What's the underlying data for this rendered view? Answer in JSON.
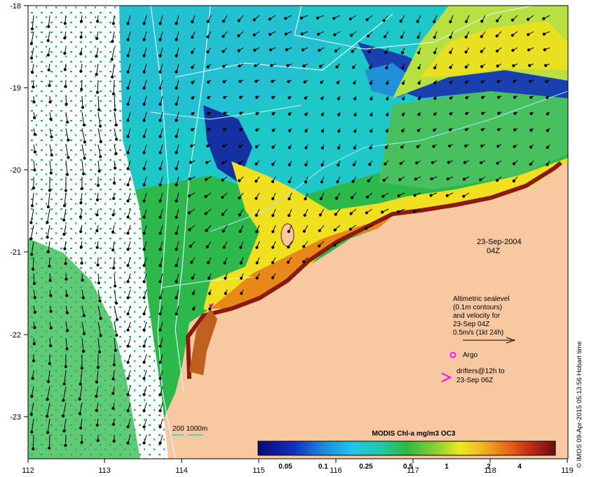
{
  "map": {
    "date": "23-Sep-2004",
    "time": "04Z",
    "credit": "© IMOS 09-Apr-2015 05:13:56 Hobart time",
    "x_ticks": [
      "112",
      "113",
      "114",
      "115",
      "116",
      "117",
      "118",
      "119"
    ],
    "y_ticks": [
      "-18",
      "-19",
      "-20",
      "-21",
      "-22",
      "-23"
    ],
    "legend": {
      "line1": "Altimetric sealevel",
      "line2": "(0.1m contours)",
      "line3": "and velocity for",
      "line4": "23-Sep 04Z",
      "line5": "0.5m/s (1kt 24h)",
      "argo": "Argo",
      "drifters1": "drifters@12h to",
      "drifters2": "23-Sep 06Z"
    },
    "bathy_label": "200  1000m",
    "colorbar": {
      "title": "MODIS Chl-a mg/m3 OC3",
      "ticks": [
        "0.05",
        "0.1",
        "0.25",
        "0.5",
        "1",
        "2",
        "4"
      ]
    },
    "colors": {
      "land": "#f8c9a0",
      "cloud": "#ffffff",
      "deep": "#1a3fa0",
      "cyan": "#1ec8d8",
      "green": "#2ab84a",
      "yellow": "#f0e020",
      "orange": "#e87818",
      "red": "#7a1010"
    }
  }
}
